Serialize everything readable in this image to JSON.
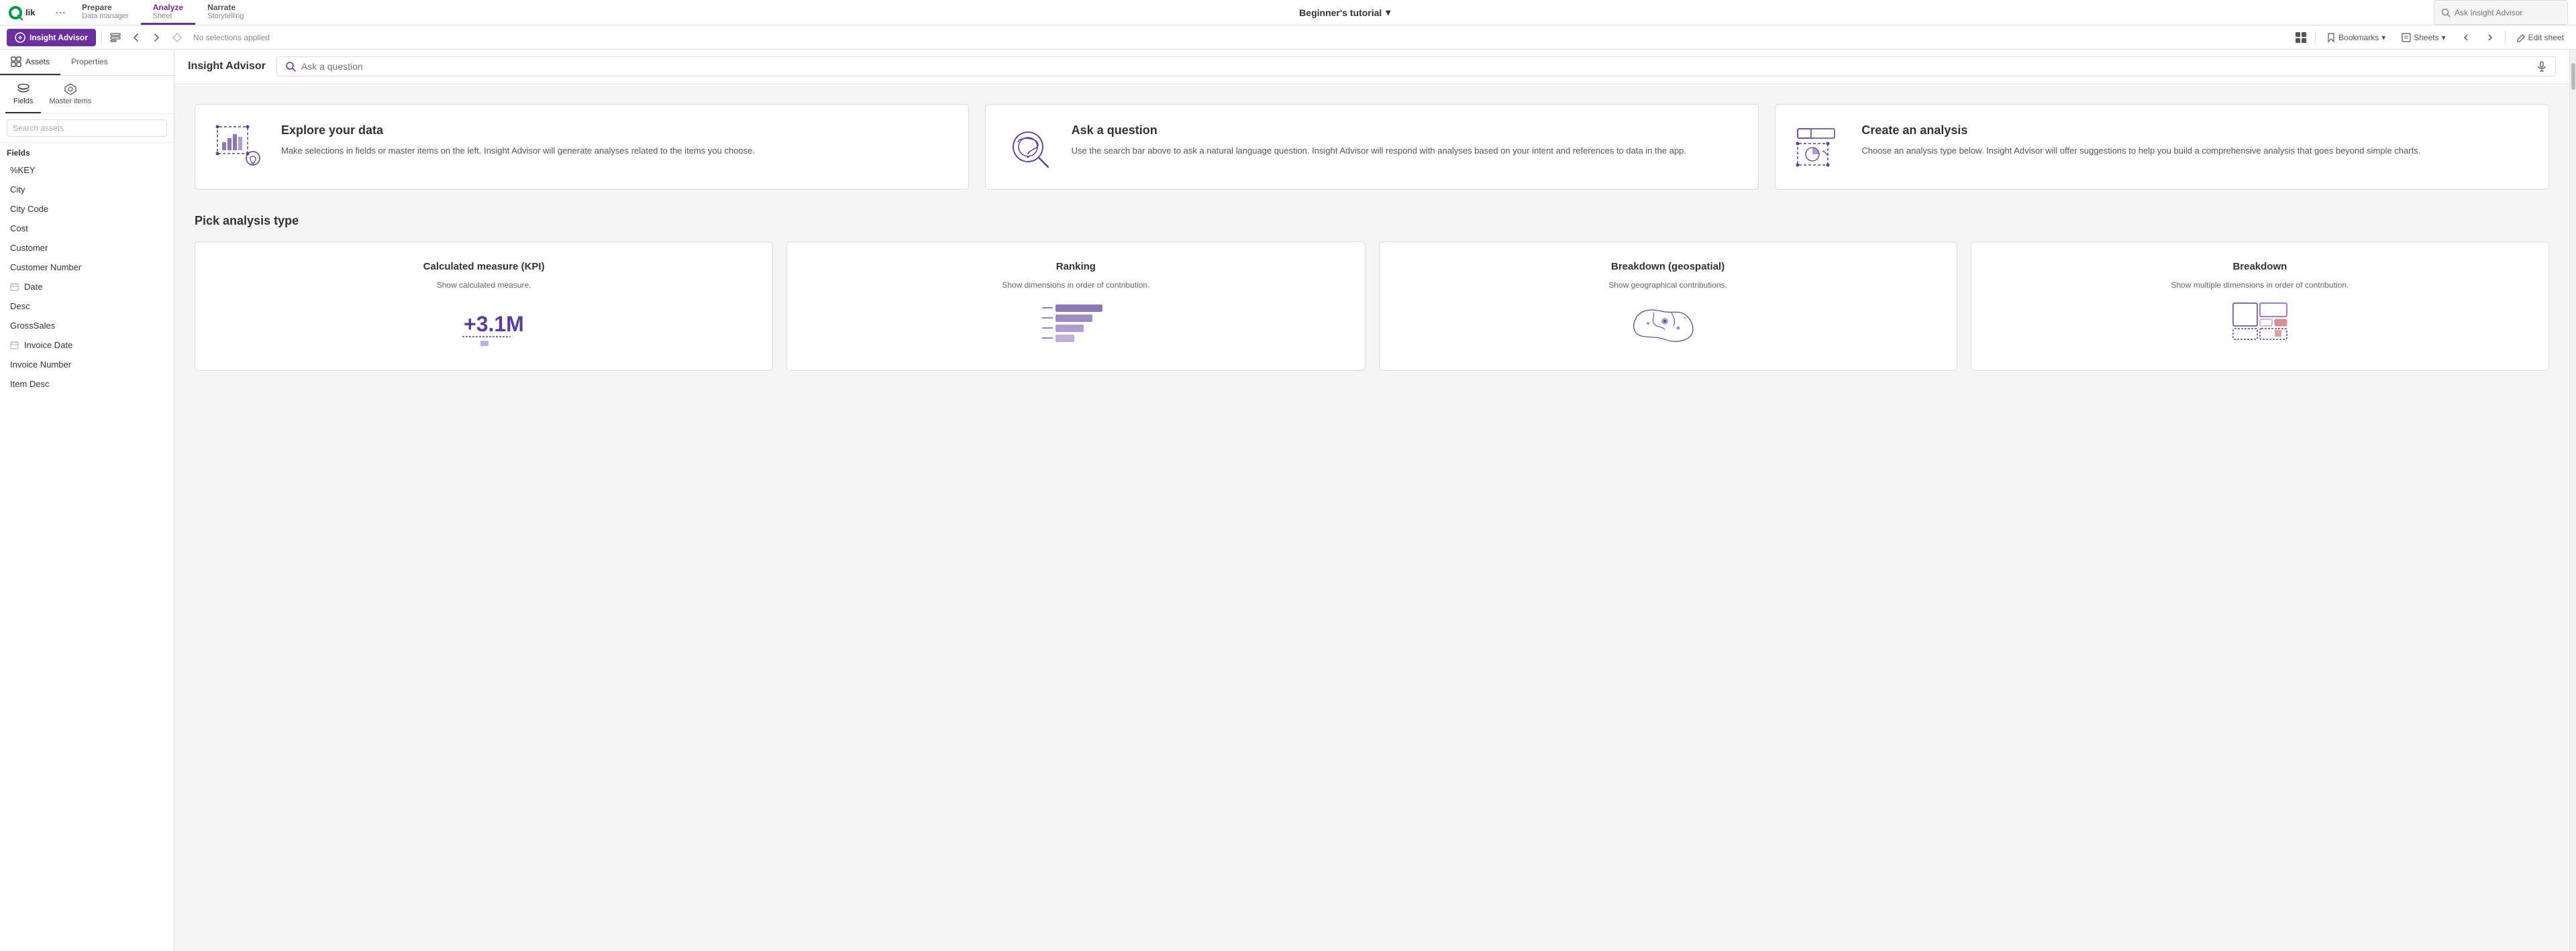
{
  "topNav": {
    "logo_alt": "Qlik",
    "more_icon": "⋯",
    "tabs": [
      {
        "id": "prepare",
        "main": "Prepare",
        "sub": "Data manager",
        "active": false
      },
      {
        "id": "analyze",
        "main": "Analyze",
        "sub": "Sheet",
        "active": true
      },
      {
        "id": "narrate",
        "main": "Narrate",
        "sub": "Storytelling",
        "active": false
      }
    ],
    "app_title": "Beginner's tutorial",
    "dropdown_icon": "▾",
    "search_placeholder": "Ask Insight Advisor"
  },
  "toolbar": {
    "insight_advisor_label": "Insight Advisor",
    "no_selections": "No selections applied",
    "bookmarks_label": "Bookmarks",
    "sheets_label": "Sheets",
    "edit_sheet_label": "Edit sheet"
  },
  "leftPanel": {
    "assets_tab": "Assets",
    "properties_tab": "Properties",
    "fields_tab_label": "Fields",
    "master_items_tab_label": "Master items",
    "search_placeholder": "Search assets",
    "fields_section_label": "Fields",
    "fields": [
      {
        "name": "%KEY",
        "icon": "field"
      },
      {
        "name": "City",
        "icon": "field"
      },
      {
        "name": "City Code",
        "icon": "field"
      },
      {
        "name": "Cost",
        "icon": "field"
      },
      {
        "name": "Customer",
        "icon": "field"
      },
      {
        "name": "Customer Number",
        "icon": "field"
      },
      {
        "name": "Date",
        "icon": "calendar"
      },
      {
        "name": "Desc",
        "icon": "field"
      },
      {
        "name": "GrossSales",
        "icon": "field"
      },
      {
        "name": "Invoice Date",
        "icon": "calendar"
      },
      {
        "name": "Invoice Number",
        "icon": "field"
      },
      {
        "name": "Item Desc",
        "icon": "field"
      }
    ]
  },
  "insightPanel": {
    "title": "Insight Advisor",
    "search_placeholder": "Ask a question"
  },
  "infoCards": [
    {
      "id": "explore",
      "title": "Explore your data",
      "desc": "Make selections in fields or master items on the left. Insight Advisor will generate analyses related to the items you choose."
    },
    {
      "id": "ask",
      "title": "Ask a question",
      "desc": "Use the search bar above to ask a natural language question. Insight Advisor will respond with analyses based on your intent and references to data in the app."
    },
    {
      "id": "create",
      "title": "Create an analysis",
      "desc": "Choose an analysis type below. Insight Advisor will offer suggestions to help you build a comprehensive analysis that goes beyond simple charts."
    }
  ],
  "analysisSection": {
    "section_title": "Pick analysis type",
    "cards": [
      {
        "id": "kpi",
        "title": "Calculated measure (KPI)",
        "desc": "Show calculated measure.",
        "visual": "kpi"
      },
      {
        "id": "ranking",
        "title": "Ranking",
        "desc": "Show dimensions in order of contribution.",
        "visual": "ranking"
      },
      {
        "id": "geospatial",
        "title": "Breakdown (geospatial)",
        "desc": "Show geographical contributions.",
        "visual": "geospatial"
      },
      {
        "id": "breakdown",
        "title": "Breakdown",
        "desc": "Show multiple dimensions in order of contribution.",
        "visual": "breakdown"
      }
    ]
  },
  "colors": {
    "brand_purple": "#6b2fa0",
    "active_nav": "#6b2fa0",
    "icon_purple": "#5c3d9e",
    "border": "#dddddd",
    "bg": "#f5f5f5",
    "white": "#ffffff"
  }
}
